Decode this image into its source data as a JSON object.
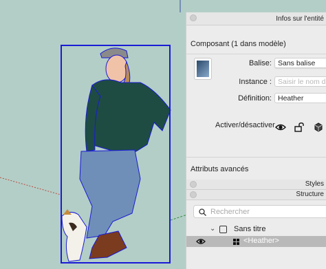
{
  "panel": {
    "title": "Infos sur l'entité",
    "component_count": "Composant (1 dans modèle)",
    "tag_label": "Balise:",
    "tag_value": "Sans balise",
    "instance_label": "Instance :",
    "instance_placeholder": "Saisir le nom de l'instance",
    "definition_label": "Définition:",
    "definition_value": "Heather",
    "toggle_label": "Activer/désactiver",
    "advanced_label": "Attributs avancés"
  },
  "styles_tray": {
    "title": "Styles"
  },
  "structure_tray": {
    "title": "Structure",
    "search_placeholder": "Rechercher",
    "root_item": "Sans titre",
    "child_item": "<Heather>"
  }
}
